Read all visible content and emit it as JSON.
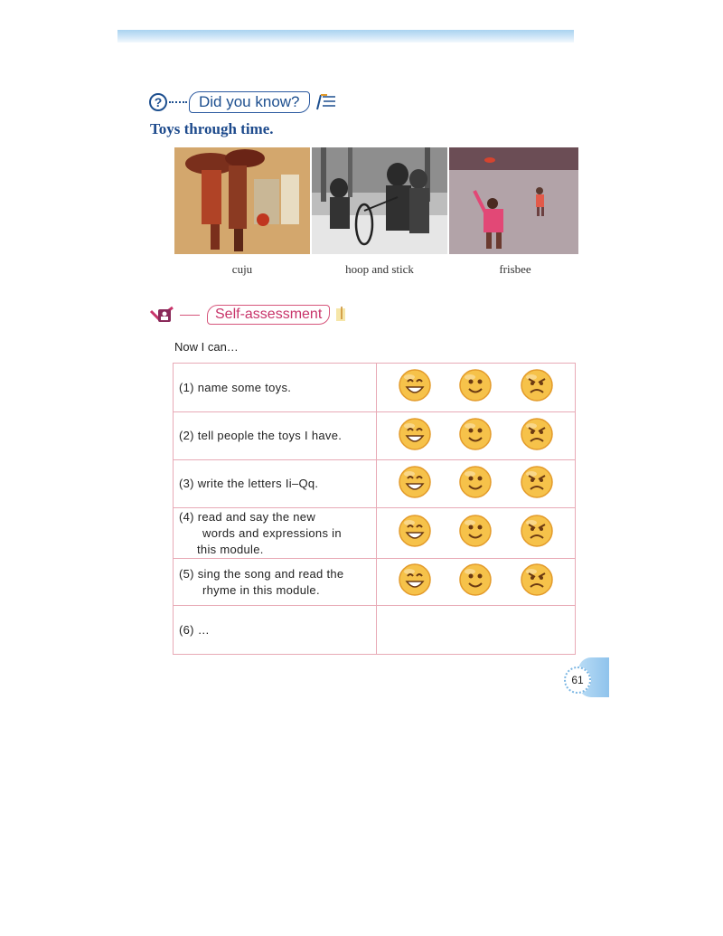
{
  "did_you_know": {
    "label": "Did you know?"
  },
  "toys_title": "Toys through time.",
  "photos": [
    {
      "caption": "cuju"
    },
    {
      "caption": "hoop and stick"
    },
    {
      "caption": "frisbee"
    }
  ],
  "self_assessment": {
    "label": "Self-assessment",
    "intro": "Now I can…",
    "rows": [
      {
        "line1": "(1) name some toys.",
        "line2": "",
        "line3": "",
        "faces": true
      },
      {
        "line1": "(2) tell people the toys I have.",
        "line2": "",
        "line3": "",
        "faces": true
      },
      {
        "line1": "(3)  write the letters Ii–Qq.",
        "line2": "",
        "line3": "",
        "faces": true
      },
      {
        "line1": "(4) read and say the new",
        "line2": "words and expressions in",
        "line3": "this module.",
        "faces": true
      },
      {
        "line1": "(5) sing the song and read the",
        "line2": "rhyme in this module.",
        "line3": "",
        "faces": true
      },
      {
        "line1": "(6) …",
        "line2": "",
        "line3": "",
        "faces": false
      }
    ],
    "face_names": [
      "big-smile-face-icon",
      "smile-face-icon",
      "frown-face-icon"
    ]
  },
  "page_number": "61",
  "colors": {
    "heading_blue": "#1d4a8c",
    "self_assessment_pink": "#c8346a",
    "table_border": "#e8aab6",
    "face_yellow": "#f6c24a"
  }
}
